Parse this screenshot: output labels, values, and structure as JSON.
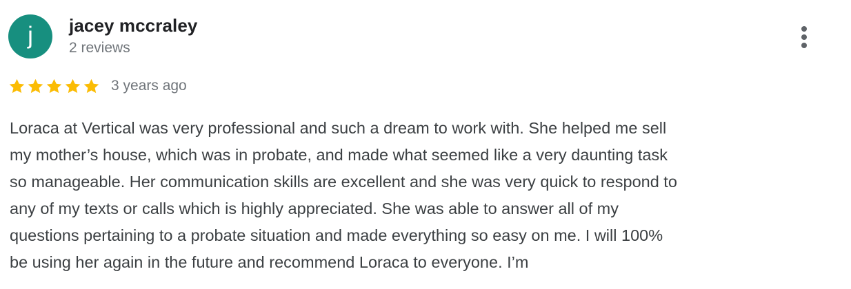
{
  "review": {
    "author": {
      "initial": "j",
      "name": "jacey mccraley",
      "review_count": "2 reviews",
      "avatar_color": "#178f7f"
    },
    "rating": {
      "stars": 5,
      "max_stars": 5,
      "star_color": "#fbbc04"
    },
    "date": "3 years ago",
    "text": "Loraca at Vertical was very professional and such a dream to work with. She helped me sell\nmy mother’s house, which was in probate, and made what seemed like a very daunting task\nso manageable. Her communication skills are excellent and she was very quick to respond to\nany of my texts or calls which is highly appreciated. She was able to answer all of my\nquestions pertaining to a probate situation and made everything so easy on me. I will 100%\nbe using her again in the future and recommend Loraca to everyone. I’m",
    "more_icon": "more-vert-icon"
  }
}
